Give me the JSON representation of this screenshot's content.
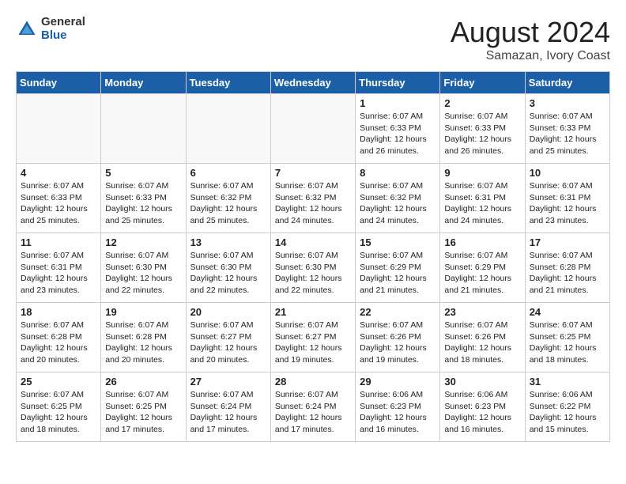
{
  "header": {
    "logo_general": "General",
    "logo_blue": "Blue",
    "month_year": "August 2024",
    "location": "Samazan, Ivory Coast"
  },
  "days_of_week": [
    "Sunday",
    "Monday",
    "Tuesday",
    "Wednesday",
    "Thursday",
    "Friday",
    "Saturday"
  ],
  "weeks": [
    [
      {
        "num": "",
        "info": ""
      },
      {
        "num": "",
        "info": ""
      },
      {
        "num": "",
        "info": ""
      },
      {
        "num": "",
        "info": ""
      },
      {
        "num": "1",
        "info": "Sunrise: 6:07 AM\nSunset: 6:33 PM\nDaylight: 12 hours\nand 26 minutes."
      },
      {
        "num": "2",
        "info": "Sunrise: 6:07 AM\nSunset: 6:33 PM\nDaylight: 12 hours\nand 26 minutes."
      },
      {
        "num": "3",
        "info": "Sunrise: 6:07 AM\nSunset: 6:33 PM\nDaylight: 12 hours\nand 25 minutes."
      }
    ],
    [
      {
        "num": "4",
        "info": "Sunrise: 6:07 AM\nSunset: 6:33 PM\nDaylight: 12 hours\nand 25 minutes."
      },
      {
        "num": "5",
        "info": "Sunrise: 6:07 AM\nSunset: 6:33 PM\nDaylight: 12 hours\nand 25 minutes."
      },
      {
        "num": "6",
        "info": "Sunrise: 6:07 AM\nSunset: 6:32 PM\nDaylight: 12 hours\nand 25 minutes."
      },
      {
        "num": "7",
        "info": "Sunrise: 6:07 AM\nSunset: 6:32 PM\nDaylight: 12 hours\nand 24 minutes."
      },
      {
        "num": "8",
        "info": "Sunrise: 6:07 AM\nSunset: 6:32 PM\nDaylight: 12 hours\nand 24 minutes."
      },
      {
        "num": "9",
        "info": "Sunrise: 6:07 AM\nSunset: 6:31 PM\nDaylight: 12 hours\nand 24 minutes."
      },
      {
        "num": "10",
        "info": "Sunrise: 6:07 AM\nSunset: 6:31 PM\nDaylight: 12 hours\nand 23 minutes."
      }
    ],
    [
      {
        "num": "11",
        "info": "Sunrise: 6:07 AM\nSunset: 6:31 PM\nDaylight: 12 hours\nand 23 minutes."
      },
      {
        "num": "12",
        "info": "Sunrise: 6:07 AM\nSunset: 6:30 PM\nDaylight: 12 hours\nand 22 minutes."
      },
      {
        "num": "13",
        "info": "Sunrise: 6:07 AM\nSunset: 6:30 PM\nDaylight: 12 hours\nand 22 minutes."
      },
      {
        "num": "14",
        "info": "Sunrise: 6:07 AM\nSunset: 6:30 PM\nDaylight: 12 hours\nand 22 minutes."
      },
      {
        "num": "15",
        "info": "Sunrise: 6:07 AM\nSunset: 6:29 PM\nDaylight: 12 hours\nand 21 minutes."
      },
      {
        "num": "16",
        "info": "Sunrise: 6:07 AM\nSunset: 6:29 PM\nDaylight: 12 hours\nand 21 minutes."
      },
      {
        "num": "17",
        "info": "Sunrise: 6:07 AM\nSunset: 6:28 PM\nDaylight: 12 hours\nand 21 minutes."
      }
    ],
    [
      {
        "num": "18",
        "info": "Sunrise: 6:07 AM\nSunset: 6:28 PM\nDaylight: 12 hours\nand 20 minutes."
      },
      {
        "num": "19",
        "info": "Sunrise: 6:07 AM\nSunset: 6:28 PM\nDaylight: 12 hours\nand 20 minutes."
      },
      {
        "num": "20",
        "info": "Sunrise: 6:07 AM\nSunset: 6:27 PM\nDaylight: 12 hours\nand 20 minutes."
      },
      {
        "num": "21",
        "info": "Sunrise: 6:07 AM\nSunset: 6:27 PM\nDaylight: 12 hours\nand 19 minutes."
      },
      {
        "num": "22",
        "info": "Sunrise: 6:07 AM\nSunset: 6:26 PM\nDaylight: 12 hours\nand 19 minutes."
      },
      {
        "num": "23",
        "info": "Sunrise: 6:07 AM\nSunset: 6:26 PM\nDaylight: 12 hours\nand 18 minutes."
      },
      {
        "num": "24",
        "info": "Sunrise: 6:07 AM\nSunset: 6:25 PM\nDaylight: 12 hours\nand 18 minutes."
      }
    ],
    [
      {
        "num": "25",
        "info": "Sunrise: 6:07 AM\nSunset: 6:25 PM\nDaylight: 12 hours\nand 18 minutes."
      },
      {
        "num": "26",
        "info": "Sunrise: 6:07 AM\nSunset: 6:25 PM\nDaylight: 12 hours\nand 17 minutes."
      },
      {
        "num": "27",
        "info": "Sunrise: 6:07 AM\nSunset: 6:24 PM\nDaylight: 12 hours\nand 17 minutes."
      },
      {
        "num": "28",
        "info": "Sunrise: 6:07 AM\nSunset: 6:24 PM\nDaylight: 12 hours\nand 17 minutes."
      },
      {
        "num": "29",
        "info": "Sunrise: 6:06 AM\nSunset: 6:23 PM\nDaylight: 12 hours\nand 16 minutes."
      },
      {
        "num": "30",
        "info": "Sunrise: 6:06 AM\nSunset: 6:23 PM\nDaylight: 12 hours\nand 16 minutes."
      },
      {
        "num": "31",
        "info": "Sunrise: 6:06 AM\nSunset: 6:22 PM\nDaylight: 12 hours\nand 15 minutes."
      }
    ]
  ]
}
